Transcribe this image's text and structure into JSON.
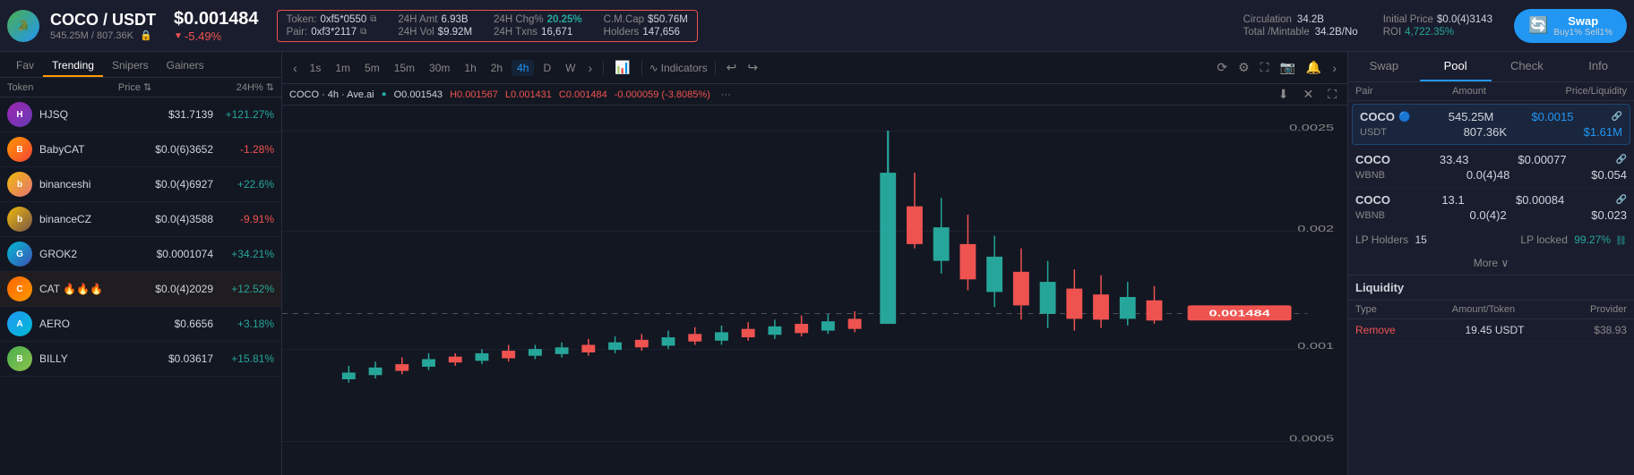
{
  "header": {
    "token_logo_text": "🐊",
    "token_name": "COCO / USDT",
    "token_market": "545.25M / 807.36K",
    "token_price": "$0.001484",
    "token_change": "-5.49%",
    "info_box": {
      "token_label": "Token:",
      "token_value": "0xf5*0550",
      "pair_label": "Pair:",
      "pair_value": "0xf3*2117",
      "amt_label": "24H Amt",
      "amt_value": "6.93B",
      "chg_label": "24H Chg%",
      "chg_value": "20.25%",
      "cap_label": "C.M.Cap",
      "cap_value": "$50.76M",
      "vol_label": "24H Vol",
      "vol_value": "$9.92M",
      "txns_label": "24H Txns",
      "txns_value": "16,671",
      "holders_label": "Holders",
      "holders_value": "147,656"
    },
    "circulation_label": "Circulation",
    "circulation_value": "34.2B",
    "total_label": "Total /Mintable",
    "total_value": "34.2B/No",
    "initial_price_label": "Initial Price",
    "initial_price_value": "$0.0(4)3143",
    "roi_label": "ROI",
    "roi_value": "4,722.35%",
    "swap_label": "Swap",
    "swap_sub": "Buy1% Sell1%"
  },
  "sidebar": {
    "tabs": [
      "Fav",
      "Trending",
      "Snipers",
      "Gainers"
    ],
    "active_tab": "Trending",
    "headers": [
      "Token",
      "Price ⇅",
      "24H% ⇅"
    ],
    "tokens": [
      {
        "name": "HJSQ",
        "price": "$31.7139",
        "change": "+121.27%",
        "positive": true,
        "avatar_class": "avatar-hjsq",
        "letter": "H"
      },
      {
        "name": "BabyCAT",
        "price": "$0.0(6)3652",
        "change": "-1.28%",
        "positive": false,
        "avatar_class": "avatar-babycat",
        "letter": "B"
      },
      {
        "name": "binanceshi",
        "price": "$0.0(4)6927",
        "change": "+22.6%",
        "positive": true,
        "avatar_class": "avatar-binanceshi",
        "letter": "b"
      },
      {
        "name": "binanceCZ",
        "price": "$0.0(4)3588",
        "change": "-9.91%",
        "positive": false,
        "avatar_class": "avatar-binancecz",
        "letter": "b"
      },
      {
        "name": "GROK2",
        "price": "$0.0001074",
        "change": "+34.21%",
        "positive": true,
        "avatar_class": "avatar-grok2",
        "letter": "G"
      },
      {
        "name": "CAT 🔥🔥🔥",
        "price": "$0.0(4)2029",
        "change": "+12.52%",
        "positive": true,
        "avatar_class": "avatar-cat",
        "letter": "C"
      },
      {
        "name": "AERO",
        "price": "$0.6656",
        "change": "+3.18%",
        "positive": true,
        "avatar_class": "avatar-aero",
        "letter": "A"
      },
      {
        "name": "BILLY",
        "price": "$0.03617",
        "change": "+15.81%",
        "positive": true,
        "avatar_class": "avatar-billy",
        "letter": "B"
      }
    ]
  },
  "chart": {
    "timeframes": [
      "1s",
      "1m",
      "5m",
      "15m",
      "30m",
      "1h",
      "2h",
      "4h",
      "D",
      "W"
    ],
    "active_tf": "4h",
    "pair_info": "COCO · 4h · Ave.ai",
    "ohlc": {
      "o_label": "O",
      "o_value": "0.001543",
      "h_label": "H",
      "h_value": "0.001567",
      "l_label": "L",
      "l_value": "0.001431",
      "c_label": "C",
      "c_value": "0.001484",
      "change": "-0.000059 (-3.8085%)"
    },
    "price_label": "0.001484",
    "indicators_label": "Indicators",
    "y_labels": [
      "0.0025",
      "0.002",
      "0.001",
      "0.0005"
    ]
  },
  "right_panel": {
    "tabs": [
      "Swap",
      "Pool",
      "Check",
      "Info"
    ],
    "active_tab": "Pool",
    "pool_headers": [
      "Pair",
      "Amount",
      "Price/Liquidity"
    ],
    "pools": [
      {
        "highlighted": true,
        "token1": "COCO",
        "token2": "USDT",
        "amount1": "545.25M",
        "amount2": "807.36K",
        "price1": "$0.0015",
        "price2": "$1.61M",
        "verified": true
      },
      {
        "highlighted": false,
        "token1": "COCO",
        "token2": "WBNB",
        "amount1": "33.43",
        "amount2": "0.0(4)48",
        "price1": "$0.00077",
        "price2": "$0.054",
        "verified": false
      },
      {
        "highlighted": false,
        "token1": "COCO",
        "token2": "WBNB",
        "amount1": "13.1",
        "amount2": "0.0(4)2",
        "price1": "$0.00084",
        "price2": "$0.023",
        "verified": false
      }
    ],
    "lp_holders_label": "LP Holders",
    "lp_holders_value": "15",
    "lp_locked_label": "LP locked",
    "lp_locked_value": "99.27%",
    "more_label": "More ∨",
    "liquidity_header": "Liquidity",
    "liq_headers": [
      "Type",
      "Amount/Token",
      "Provider"
    ],
    "liq_rows": [
      {
        "type": "Remove",
        "amount": "19.45 USDT",
        "provider": "$38.93"
      }
    ]
  }
}
